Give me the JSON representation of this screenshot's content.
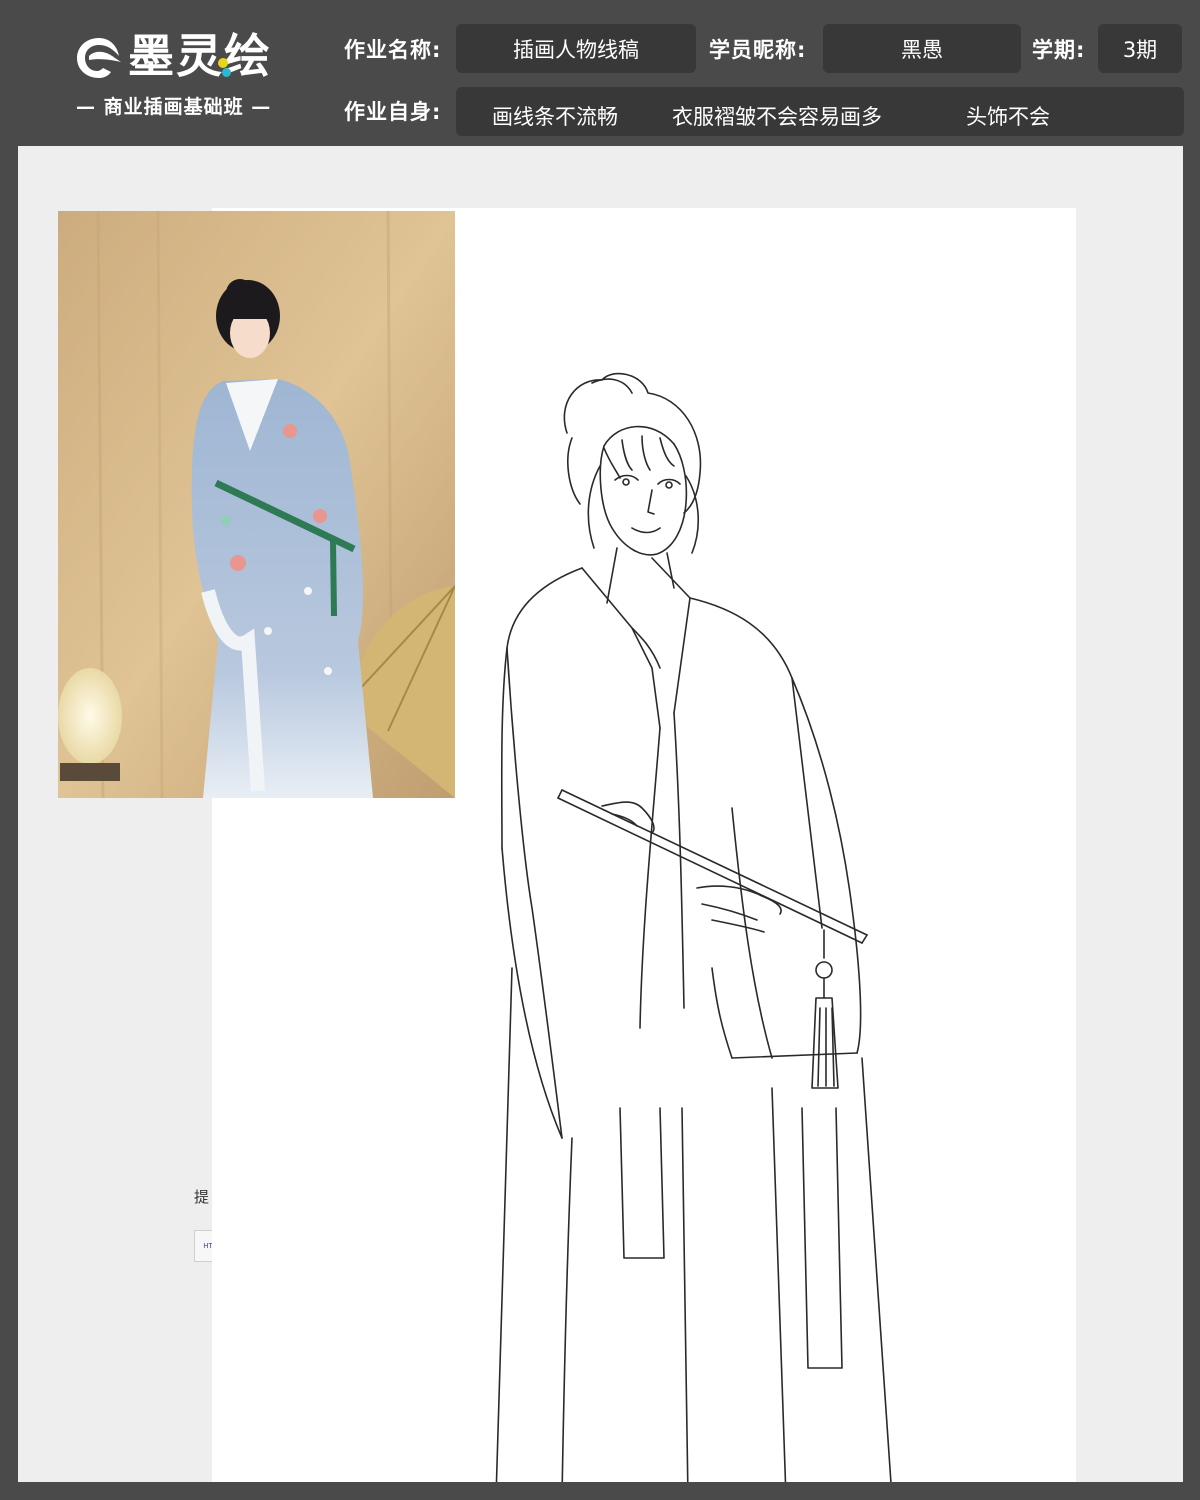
{
  "header": {
    "logo_title": "墨灵绘",
    "logo_subtitle": "— 商业插画基础班 —",
    "assignment_name_label": "作业名称:",
    "assignment_name": "插画人物线稿",
    "student_nickname_label": "学员昵称:",
    "student_nickname": "黑愚",
    "term_label": "学期:",
    "term": "3期",
    "self_assessment_label": "作业自身:",
    "self_assessment_notes": [
      "画线条不流畅",
      "衣服褶皱不会容易画多",
      "头饰不会"
    ]
  },
  "canvas": {
    "stray_text": "提",
    "stray_button_label": "HT"
  },
  "icons": {
    "logo": "brush-logo-icon"
  },
  "colors": {
    "header_bg": "#4a4a4a",
    "box_bg": "#383838",
    "canvas_bg": "#eeeeee",
    "paper_bg": "#ffffff"
  }
}
